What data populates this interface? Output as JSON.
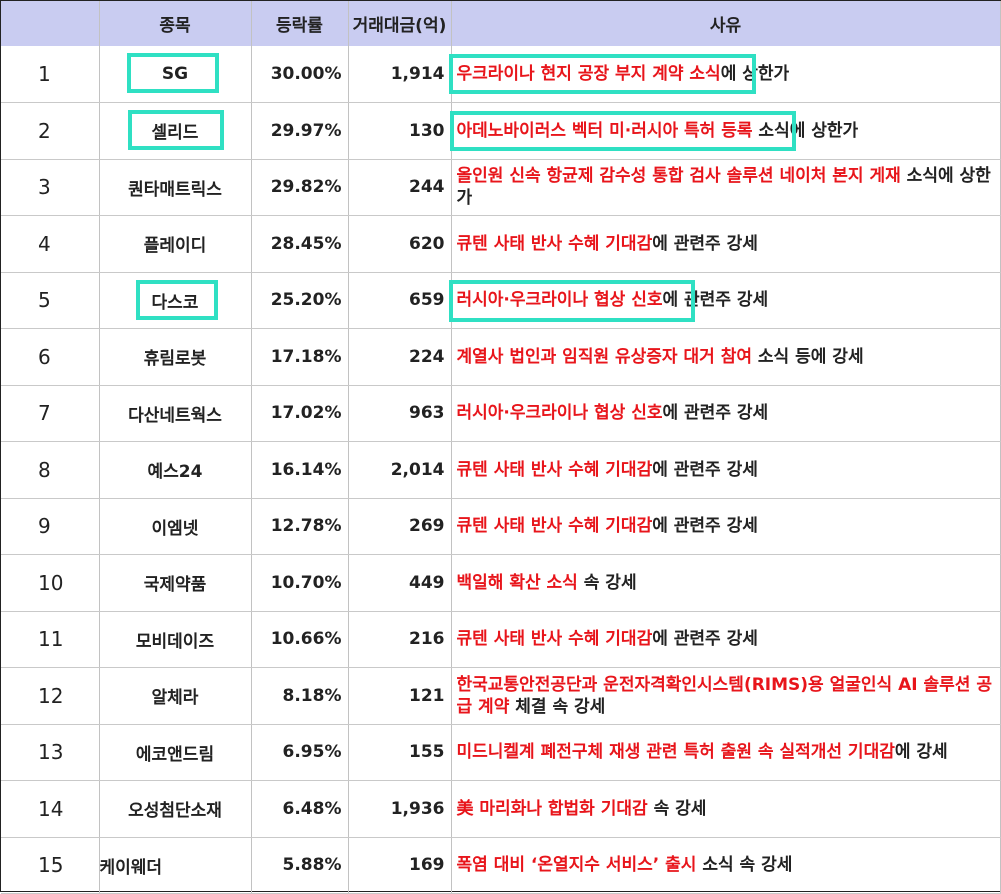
{
  "header": {
    "col_rank": "",
    "col_name": "종목",
    "col_rate": "등락률",
    "col_amount": "거래대금(억)",
    "col_reason": "사유"
  },
  "rows": [
    {
      "rank": "1",
      "name": "SG",
      "rate": "30.00%",
      "amount": "1,914",
      "reason_red": "우크라이나 현지 공장 부지 계약 소식",
      "reason_black": "에 상한가"
    },
    {
      "rank": "2",
      "name": "셀리드",
      "rate": "29.97%",
      "amount": "130",
      "reason_red": "아데노바이러스 벡터 미·러시아 특허 등록",
      "reason_black": " 소식에 상한가"
    },
    {
      "rank": "3",
      "name": "퀀타매트릭스",
      "rate": "29.82%",
      "amount": "244",
      "reason_red": "올인원 신속 항균제 감수성 통합 검사 솔루션 네이처 본지 게재",
      "reason_black": " 소식에 상한가"
    },
    {
      "rank": "4",
      "name": "플레이디",
      "rate": "28.45%",
      "amount": "620",
      "reason_red": "큐텐 사태 반사 수혜 기대감",
      "reason_black": "에 관련주 강세"
    },
    {
      "rank": "5",
      "name": "다스코",
      "rate": "25.20%",
      "amount": "659",
      "reason_red": "러시아·우크라이나 협상 신호",
      "reason_black": "에 관련주 강세"
    },
    {
      "rank": "6",
      "name": "휴림로봇",
      "rate": "17.18%",
      "amount": "224",
      "reason_red": "계열사 법인과 임직원 유상증자 대거 참여",
      "reason_black": " 소식 등에 강세"
    },
    {
      "rank": "7",
      "name": "다산네트웍스",
      "rate": "17.02%",
      "amount": "963",
      "reason_red": "러시아·우크라이나 협상 신호",
      "reason_black": "에 관련주 강세"
    },
    {
      "rank": "8",
      "name": "예스24",
      "rate": "16.14%",
      "amount": "2,014",
      "reason_red": "큐텐 사태 반사 수혜 기대감",
      "reason_black": "에 관련주 강세"
    },
    {
      "rank": "9",
      "name": "이엠넷",
      "rate": "12.78%",
      "amount": "269",
      "reason_red": "큐텐 사태 반사 수혜 기대감",
      "reason_black": "에 관련주 강세"
    },
    {
      "rank": "10",
      "name": "국제약품",
      "rate": "10.70%",
      "amount": "449",
      "reason_red": "백일해 확산 소식",
      "reason_black": " 속 강세"
    },
    {
      "rank": "11",
      "name": "모비데이즈",
      "rate": "10.66%",
      "amount": "216",
      "reason_red": "큐텐 사태 반사 수혜 기대감",
      "reason_black": "에 관련주 강세"
    },
    {
      "rank": "12",
      "name": "알체라",
      "rate": "8.18%",
      "amount": "121",
      "reason_red": "한국교통안전공단과 운전자격확인시스템(RIMS)용 얼굴인식 AI 솔루션 공급 계약",
      "reason_black": " 체결 속 강세"
    },
    {
      "rank": "13",
      "name": "에코앤드림",
      "rate": "6.95%",
      "amount": "155",
      "reason_red": "미드니켈계 폐전구체 재생 관련 특허 출원 속 실적개선 기대감",
      "reason_black": "에 강세"
    },
    {
      "rank": "14",
      "name": "오성첨단소재",
      "rate": "6.48%",
      "amount": "1,936",
      "reason_red": "美 마리화나 합법화 기대감",
      "reason_black": " 속 강세"
    },
    {
      "rank": "15",
      "name": "케이웨더",
      "rate": "5.88%",
      "amount": "169",
      "reason_red": "폭염 대비 ‘온열지수 서비스’ 출시",
      "reason_black": " 소식 속 강세"
    }
  ],
  "highlight_color": "#2fe0c3",
  "reason_highlight_color": "#e8151b"
}
